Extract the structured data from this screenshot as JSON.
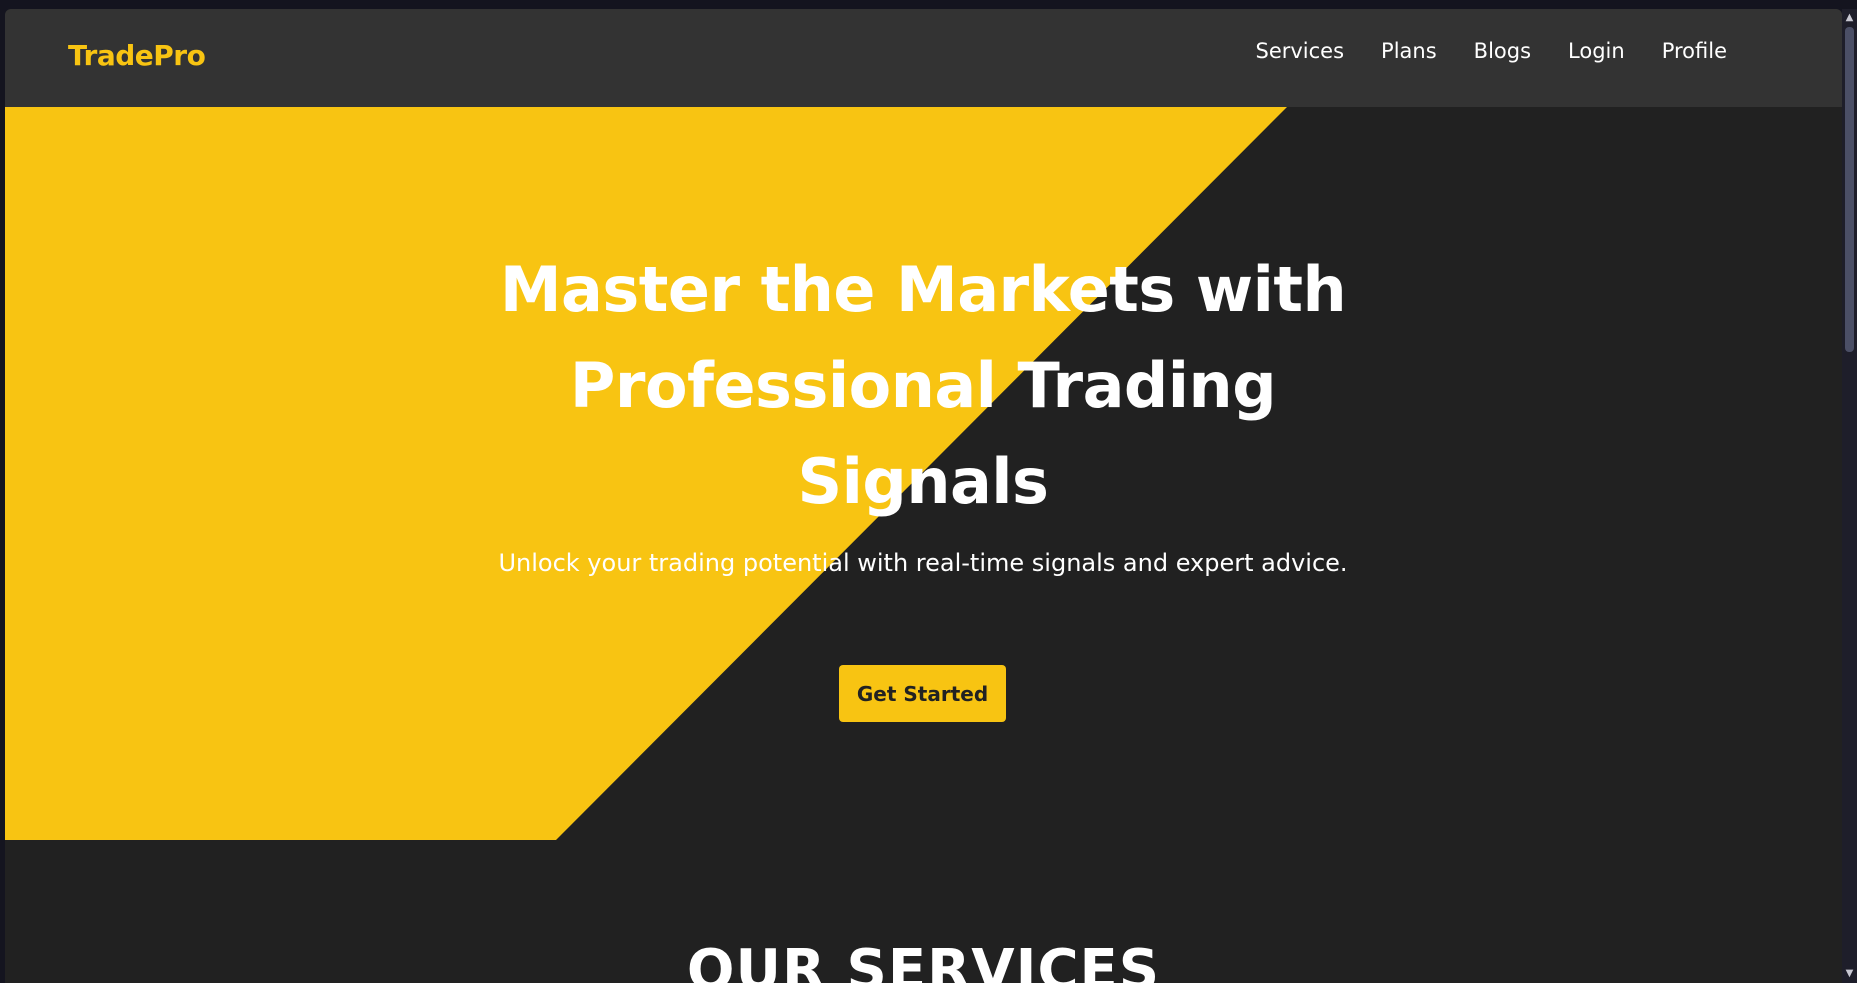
{
  "brand": {
    "name": "TradePro"
  },
  "nav": {
    "items": [
      {
        "label": "Services"
      },
      {
        "label": "Plans"
      },
      {
        "label": "Blogs"
      },
      {
        "label": "Login"
      },
      {
        "label": "Profile"
      }
    ]
  },
  "hero": {
    "title": "Master the Markets with Professional Trading Signals",
    "subtitle": "Unlock your trading potential with real-time signals and expert advice.",
    "cta_label": "Get Started"
  },
  "services": {
    "title": "OUR SERVICES"
  },
  "scrollbar": {
    "up_icon": "chevron-up-icon",
    "down_icon": "chevron-down-icon"
  },
  "colors": {
    "accent": "#f8c412",
    "dark": "#212121",
    "navbar": "#333333",
    "text": "#ffffff"
  }
}
